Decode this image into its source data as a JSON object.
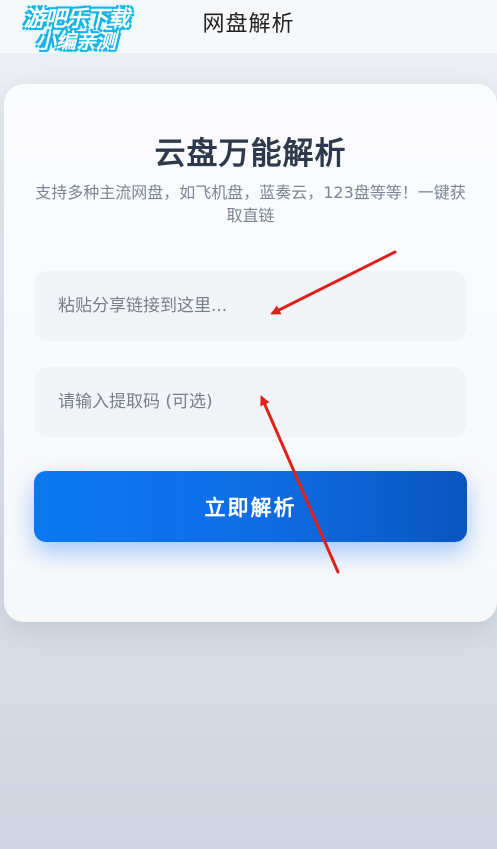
{
  "header": {
    "title": "网盘解析"
  },
  "watermark": {
    "line1": "游吧乐下载",
    "line2": "小编亲测"
  },
  "card": {
    "title": "云盘万能解析",
    "subtitle": "支持多种主流网盘，如飞机盘，蓝奏云，123盘等等！一键获取直链"
  },
  "form": {
    "link_placeholder": "粘贴分享链接到这里...",
    "code_placeholder": "请输入提取码 (可选)",
    "submit_label": "立即解析"
  },
  "colors": {
    "accent": "#0a6fe8",
    "annotation_arrow": "#e0201b"
  }
}
